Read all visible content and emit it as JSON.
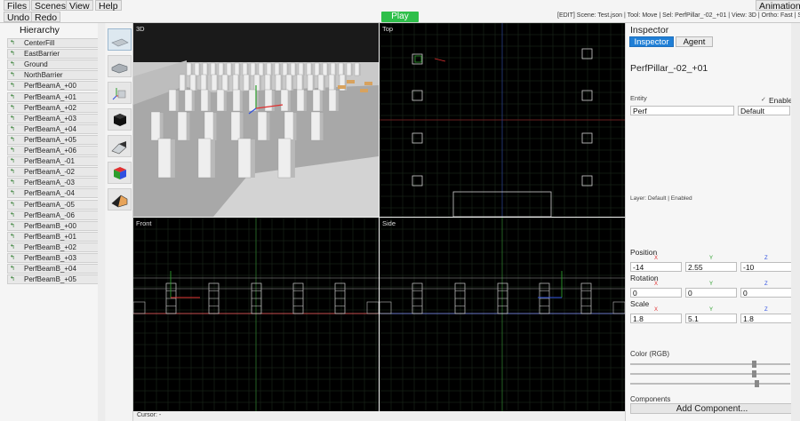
{
  "menu": {
    "files": "Files",
    "scenes": "Scenes",
    "view": "View",
    "help": "Help",
    "undo": "Undo",
    "redo": "Redo",
    "animation": "Animation",
    "play": "Play",
    "status": "[EDIT] Scene: Test.json | Tool: Move | Sel: PerfPillar_-02_+01 | View: 3D | Ortho: Fast | Snap:"
  },
  "hierarchy": {
    "title": "Hierarchy",
    "items": [
      "CenterFill",
      "EastBarrier",
      "Ground",
      "NorthBarrier",
      "PerfBeamA_+00",
      "PerfBeamA_+01",
      "PerfBeamA_+02",
      "PerfBeamA_+03",
      "PerfBeamA_+04",
      "PerfBeamA_+05",
      "PerfBeamA_+06",
      "PerfBeamA_-01",
      "PerfBeamA_-02",
      "PerfBeamA_-03",
      "PerfBeamA_-04",
      "PerfBeamA_-05",
      "PerfBeamA_-06",
      "PerfBeamB_+00",
      "PerfBeamB_+01",
      "PerfBeamB_+02",
      "PerfBeamB_+03",
      "PerfBeamB_+04",
      "PerfBeamB_+05"
    ]
  },
  "viewports": {
    "perspective": "3D",
    "top": "Top",
    "front": "Front",
    "side": "Side",
    "cursor": "Cursor: -"
  },
  "inspector": {
    "header": "Inspector",
    "tab_inspector": "Inspector",
    "tab_agent": "Agent",
    "object_name": "PerfPillar_-02_+01",
    "entity_label": "Entity",
    "enabled_label": "Enabled",
    "entity_name": "Perf",
    "entity_tag": "Default",
    "layer": "Layer: Default | Enabled",
    "position_label": "Position",
    "position": {
      "x": "-14",
      "y": "2.55",
      "z": "-10"
    },
    "rotation_label": "Rotation",
    "rotation": {
      "x": "0",
      "y": "0",
      "z": "0"
    },
    "scale_label": "Scale",
    "scale": {
      "x": "1.8",
      "y": "5.1",
      "z": "1.8"
    },
    "axis_x": "X",
    "axis_y": "Y",
    "axis_z": "Z",
    "color_label": "Color (RGB)",
    "color_rgb": {
      "r": 0.78,
      "g": 0.78,
      "b": 0.8
    },
    "components_label": "Components",
    "add_component": "Add Component..."
  },
  "colors": {
    "play": "#2fbf4b",
    "axis_x": "#e03030",
    "axis_y": "#2c9e2c",
    "axis_z": "#3050e0",
    "tab_active": "#1f7fd6"
  }
}
